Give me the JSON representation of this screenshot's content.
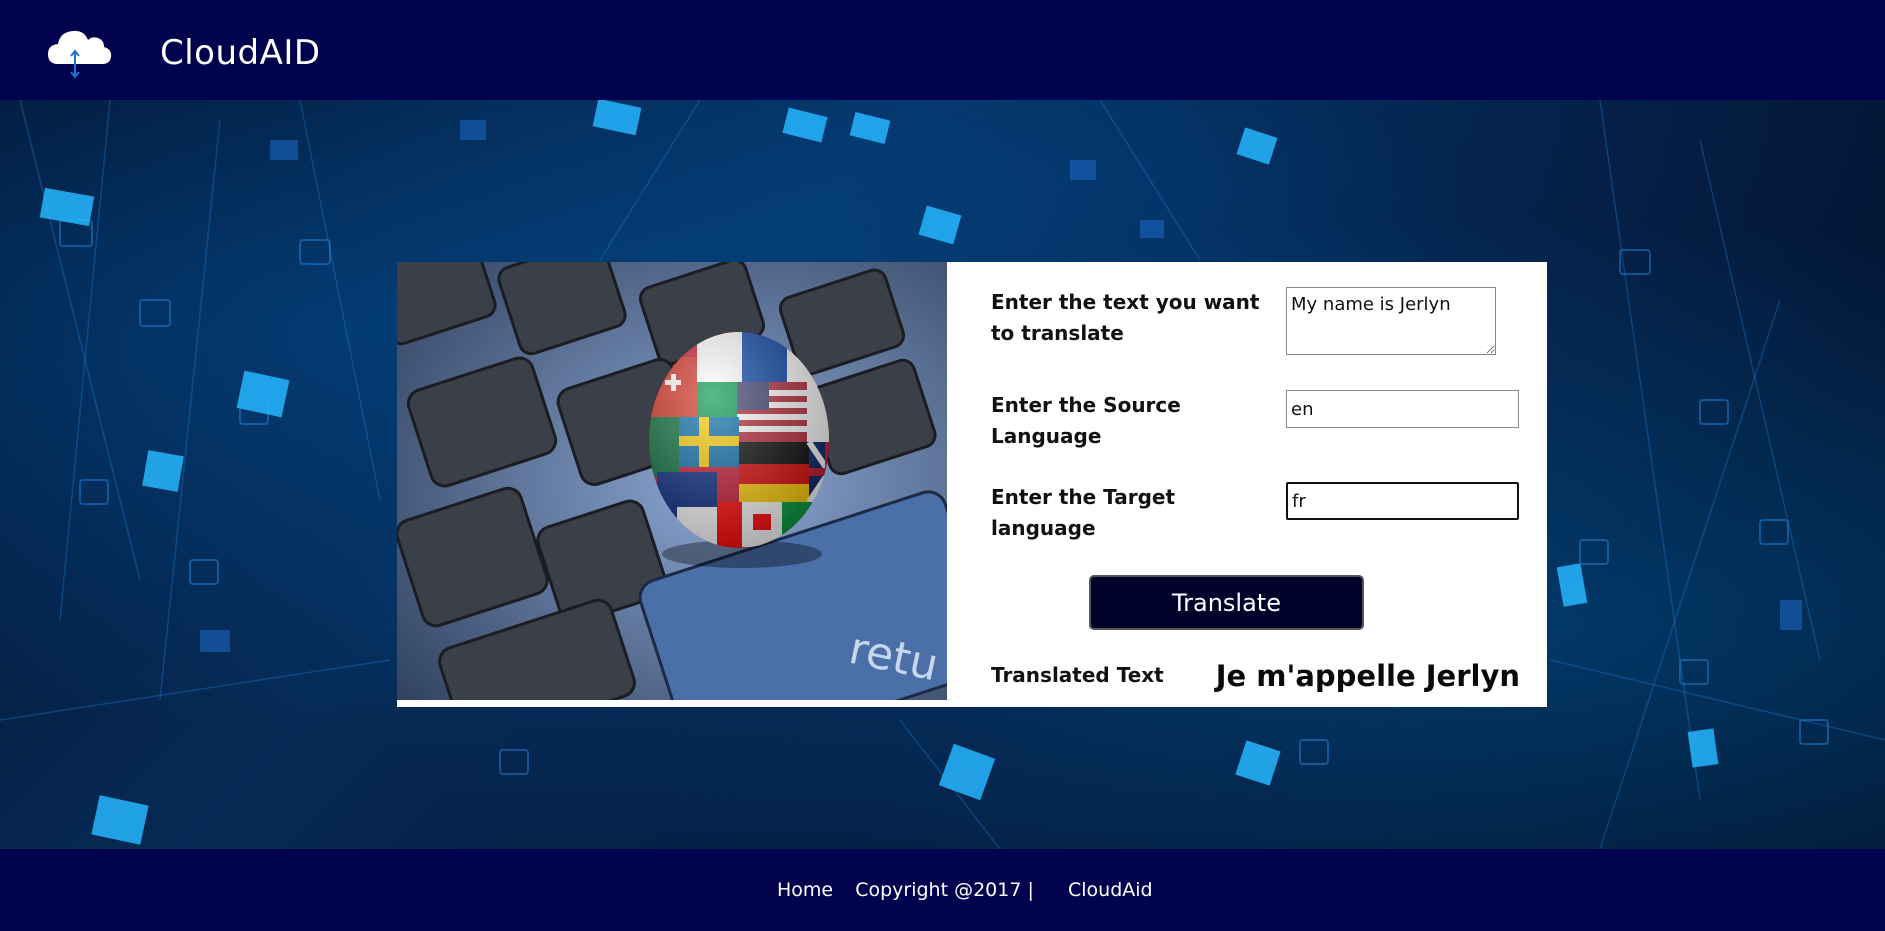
{
  "header": {
    "brand": "CloudAID",
    "logo_icon": "cloud-upload-download-icon"
  },
  "form": {
    "text_label": "Enter the text you want to translate",
    "text_value": "My name is Jerlyn",
    "source_label": "Enter the Source Language",
    "source_value": "en",
    "target_label": "Enter the Target language",
    "target_value": "fr",
    "translate_button": "Translate",
    "result_label": "Translated Text",
    "result_value": "Je m'appelle Jerlyn"
  },
  "footer": {
    "home": "Home",
    "copyright": "Copyright @2017 |",
    "company": "CloudAid"
  },
  "colors": {
    "nav_bg": "#01024d",
    "button_bg": "#01022b",
    "card_bg": "#ffffff"
  }
}
